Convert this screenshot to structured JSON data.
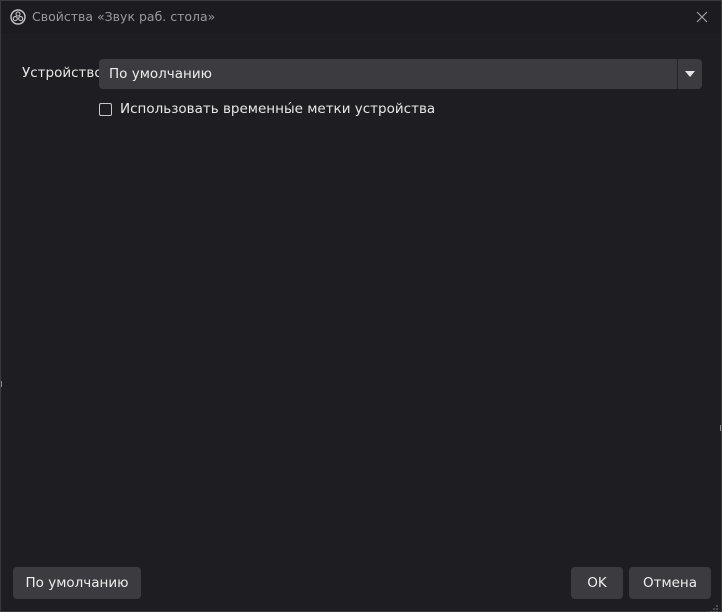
{
  "window": {
    "title": "Свойства «Звук раб. стола»",
    "app_icon": "obs-logo-icon",
    "close_icon": "close-icon"
  },
  "form": {
    "device_label": "Устройство",
    "device_value": "По умолчанию",
    "device_dropdown_icon": "chevron-down-icon",
    "timestamps_checkbox_label": "Использовать временны́е метки устройства",
    "timestamps_checked": false
  },
  "buttons": {
    "defaults_label": "По умолчанию",
    "ok_label": "OK",
    "cancel_label": "Отмена"
  },
  "colors": {
    "background": "#1e1d21",
    "control": "#3c3b40",
    "text": "#e8e8e8",
    "title_text": "#9a9a9e"
  }
}
